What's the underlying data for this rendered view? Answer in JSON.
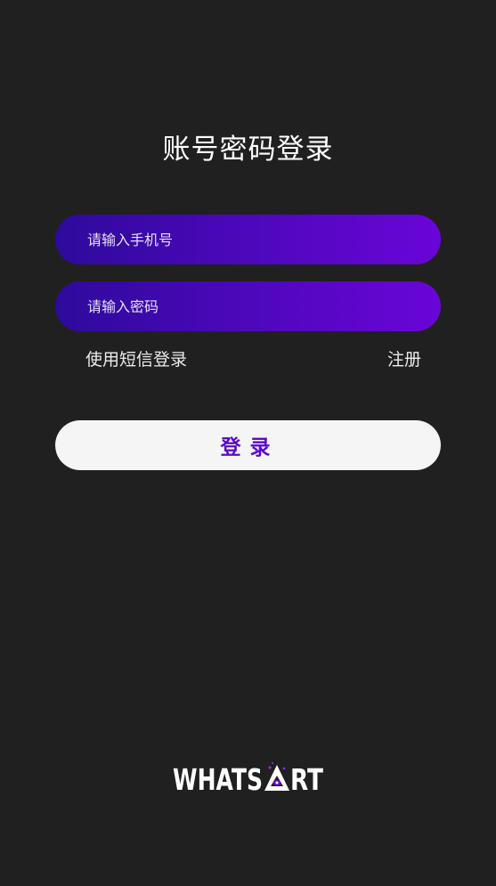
{
  "header": {
    "title": "账号密码登录"
  },
  "form": {
    "phone_placeholder": "请输入手机号",
    "password_placeholder": "请输入密码",
    "sms_login_label": "使用短信登录",
    "register_label": "注册",
    "login_button_label": "登录"
  },
  "brand": {
    "logo_text": "WHATSART",
    "logo_icon": "triangle-eye-icon",
    "accent_color": "#5b09c9"
  }
}
